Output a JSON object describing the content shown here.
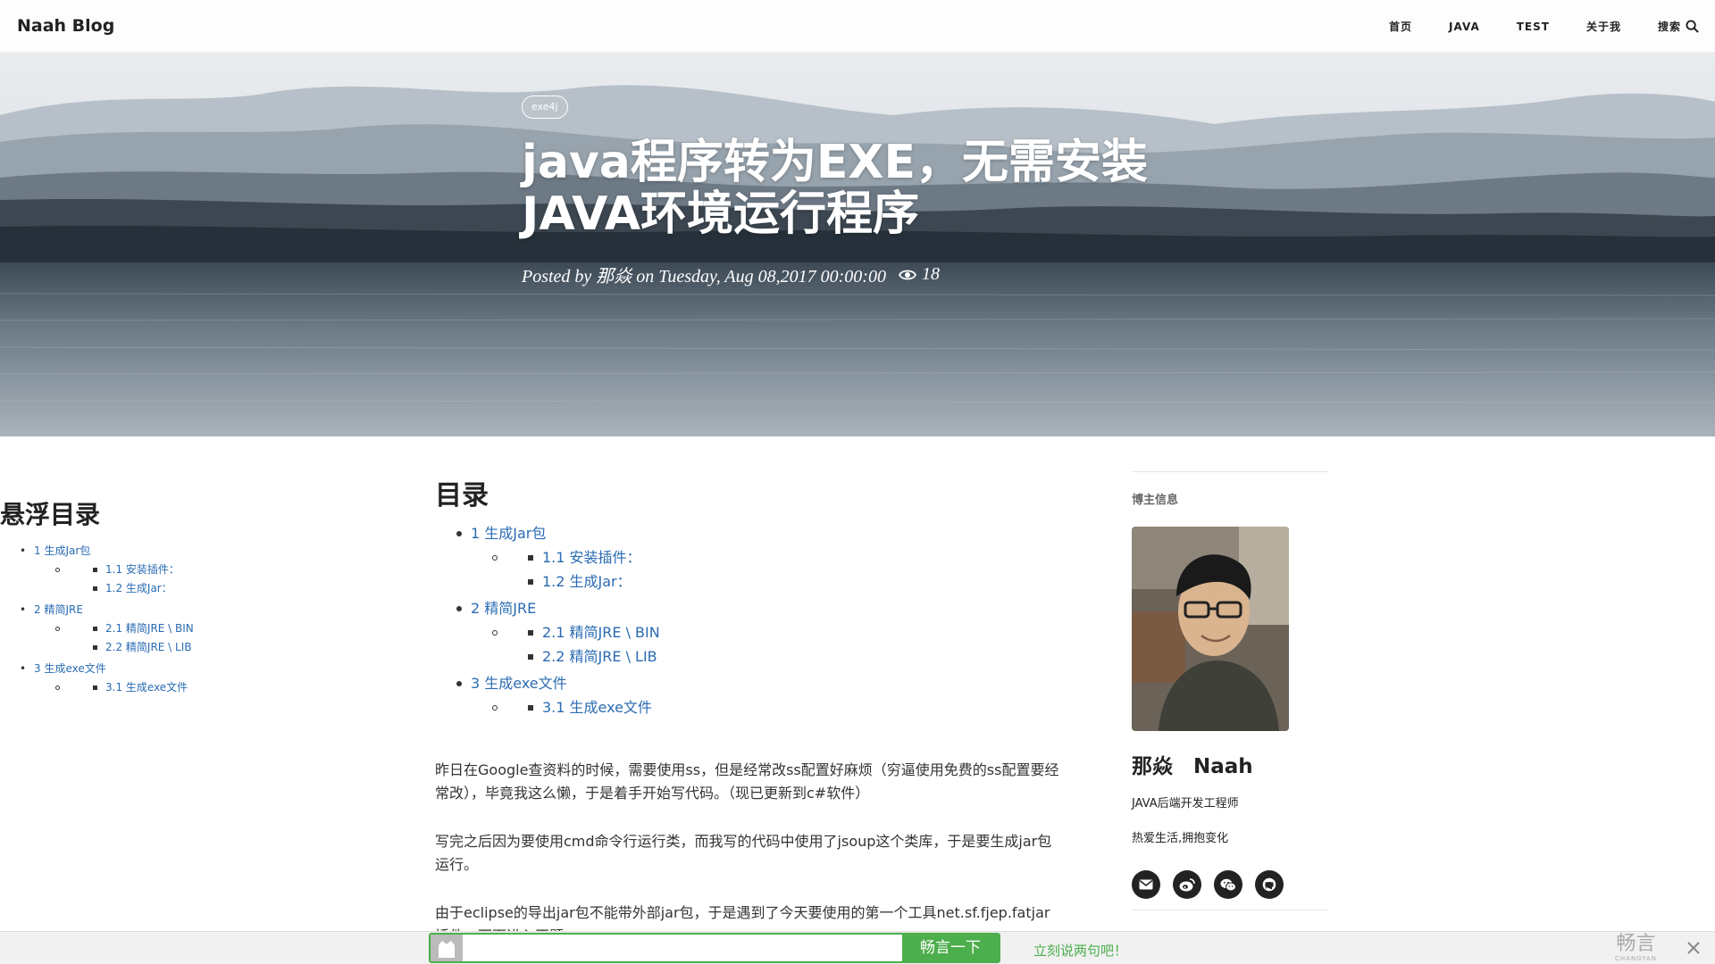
{
  "nav": {
    "brand": "Naah Blog",
    "links": [
      "首页",
      "JAVA",
      "TEST",
      "关于我",
      "搜索"
    ]
  },
  "hero": {
    "tag": "exe4j",
    "title_line1": "java程序转为EXE，无需安装",
    "title_line2": "JAVA环境运行程序",
    "meta": "Posted by 那焱 on Tuesday, Aug 08,2017 00:00:00",
    "views": "18"
  },
  "float_toc": {
    "title": "悬浮目录",
    "items": [
      {
        "level": 1,
        "label": "1 生成Jar包"
      },
      {
        "level": 2,
        "label": "1.1 安装插件："
      },
      {
        "level": 2,
        "label": "1.2 生成Jar："
      },
      {
        "level": 1,
        "label": "2 精简JRE"
      },
      {
        "level": 2,
        "label": "2.1 精简JRE \\ BIN"
      },
      {
        "level": 2,
        "label": "2.2 精简JRE \\ LIB"
      },
      {
        "level": 1,
        "label": "3 生成exe文件"
      },
      {
        "level": 2,
        "label": "3.1 生成exe文件"
      }
    ]
  },
  "article": {
    "toc_title": "目录",
    "paragraphs": [
      "昨日在Google查资料的时候，需要使用ss，但是经常改ss配置好麻烦（穷逼使用免费的ss配置要经常改），毕竟我这么懒，于是着手开始写代码。（现已更新到c#软件）",
      "写完之后因为要使用cmd命令行运行类，而我写的代码中使用了jsoup这个类库，于是要生成jar包运行。",
      "由于eclipse的导出jar包不能带外部jar包，于是遇到了今天要使用的第一个工具net.sf.fjep.fatjar插件，下面进入正题。"
    ]
  },
  "sidebar": {
    "heading": "博主信息",
    "name": "那焱　Naah",
    "role": "JAVA后端开发工程师",
    "motto": "热爱生活,拥抱变化",
    "social_icons": [
      "mail-icon",
      "weibo-icon",
      "wechat-icon",
      "github-icon"
    ]
  },
  "changyan": {
    "button": "畅言一下",
    "prompt": "立刻说两句吧！",
    "logo_cn": "畅言",
    "logo_en": "CHANGYAN"
  },
  "colors": {
    "link": "#2a6bb3",
    "changyan_green": "#4cae4c"
  }
}
